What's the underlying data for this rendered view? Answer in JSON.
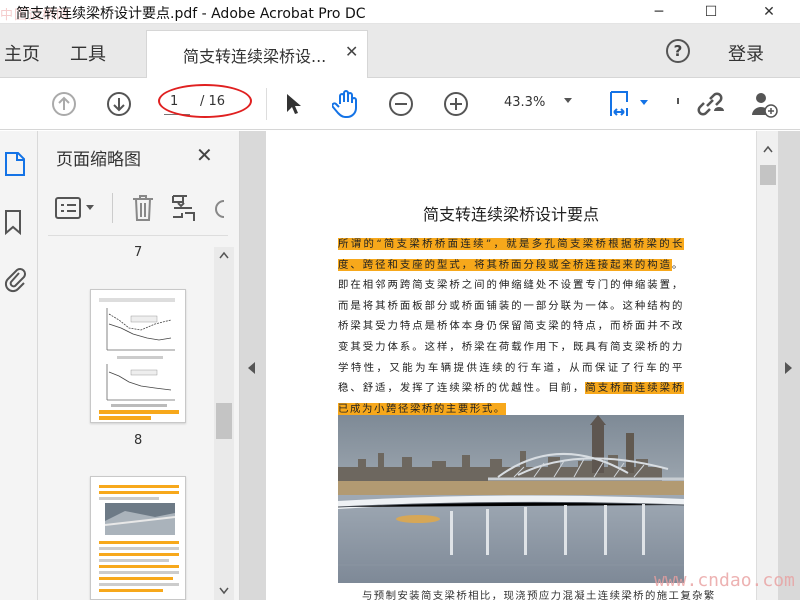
{
  "window": {
    "title": "简支转连续梁桥设计要点.pdf - Adobe Acrobat Pro DC",
    "watermark_tl": "中国道桥网",
    "minimize": "─",
    "maximize": "☐",
    "close": "✕"
  },
  "tabs": {
    "home": "主页",
    "tools": "工具",
    "document": "简支转连续梁桥设...",
    "close": "✕"
  },
  "header": {
    "help": "?",
    "login": "登录"
  },
  "toolbar": {
    "current_page": "1",
    "total_pages": "/ 16",
    "zoom": "43.3%"
  },
  "thumbnails": {
    "title": "页面缩略图",
    "close": "✕",
    "labels": [
      "7",
      "8"
    ]
  },
  "document": {
    "title": "简支转连续梁桥设计要点",
    "paragraph": {
      "hl1": "所谓的“简支梁桥桥面连续”，就是多孔简支梁桥根据桥梁的长度、跨径和支座的型式，将其桥面分段或全桥连接起来的构造",
      "mid": "。即在相邻两跨简支梁桥之间的伸缩缝处不设置专门的伸缩装置，而是将其桥面板部分或桥面铺装的一部分联为一体。这种结构的桥梁其受力特点是桥体本身仍保留简支梁的特点，而桥面并不改变其受力体系。这样，桥梁在荷载作用下，既具有简支梁桥的力学特性，又能为车辆提供连续的行车道，从而保证了行车的平稳、舒适，发挥了连续梁桥的优越性。目前，",
      "hl2": "简支桥面连续梁桥已成为小跨径梁桥的主要形式",
      "end": "。"
    },
    "next_line": "与预制安装简支梁桥相比，现浇预应力混凝土连续梁桥的施工复杂繁"
  },
  "watermark_br": "www.cndao.com",
  "colors": {
    "highlight": "#f7a81b",
    "annotation": "#e02020",
    "accent": "#1473e6"
  }
}
